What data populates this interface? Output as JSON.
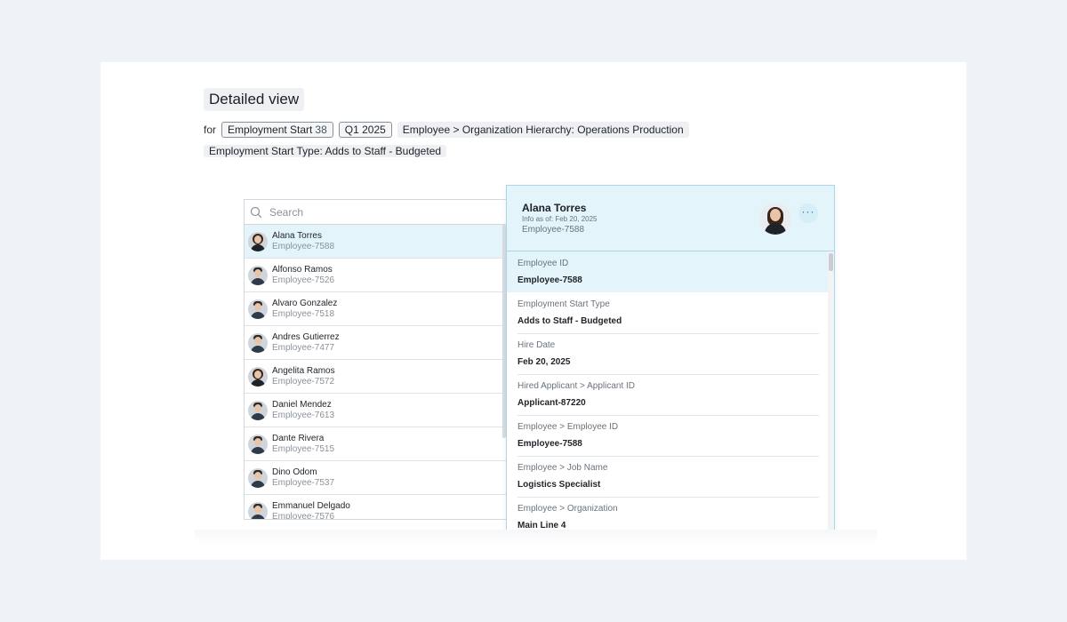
{
  "page": {
    "title": "Detailed view",
    "for_label": "for",
    "filters": {
      "metric_label": "Employment Start",
      "metric_count": "38",
      "period": "Q1 2025",
      "hierarchy": "Employee > Organization Hierarchy: Operations Production",
      "start_type": "Employment Start Type: Adds to Staff - Budgeted"
    }
  },
  "search": {
    "placeholder": "Search",
    "value": ""
  },
  "employees": [
    {
      "name": "Alana Torres",
      "id": "Employee-7588"
    },
    {
      "name": "Alfonso Ramos",
      "id": "Employee-7526"
    },
    {
      "name": "Alvaro Gonzalez",
      "id": "Employee-7518"
    },
    {
      "name": "Andres Gutierrez",
      "id": "Employee-7477"
    },
    {
      "name": "Angelita Ramos",
      "id": "Employee-7572"
    },
    {
      "name": "Daniel Mendez",
      "id": "Employee-7613"
    },
    {
      "name": "Dante Rivera",
      "id": "Employee-7515"
    },
    {
      "name": "Dino Odom",
      "id": "Employee-7537"
    },
    {
      "name": "Emmanuel Delgado",
      "id": "Employee-7576"
    }
  ],
  "detail": {
    "name": "Alana Torres",
    "as_of": "Info as of: Feb 20, 2025",
    "employee_id": "Employee-7588",
    "more_label": "···",
    "fields": [
      {
        "label": "Employee ID",
        "value": "Employee-7588"
      },
      {
        "label": "Employment Start Type",
        "value": "Adds to Staff - Budgeted"
      },
      {
        "label": "Hire Date",
        "value": "Feb 20, 2025"
      },
      {
        "label": "Hired Applicant > Applicant ID",
        "value": "Applicant-87220"
      },
      {
        "label": "Employee > Employee ID",
        "value": "Employee-7588"
      },
      {
        "label": "Employee > Job Name",
        "value": "Logistics Specialist"
      },
      {
        "label": "Employee > Organization",
        "value": "Main Line 4"
      }
    ]
  },
  "colors": {
    "page_bg": "#eff3f7",
    "selected_bg": "#e3f4fb",
    "panel_border": "#a9d6ea"
  }
}
